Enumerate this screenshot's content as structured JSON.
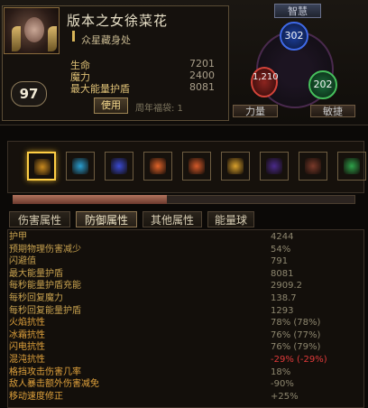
{
  "character": {
    "name": "版本之女徐菜花",
    "subline": "众星藏身处",
    "level": "97",
    "use_button": "使用",
    "anniversary_label": "周年福袋: 1",
    "stats": [
      {
        "label": "生命",
        "value": "7201"
      },
      {
        "label": "魔力",
        "value": "2400"
      },
      {
        "label": "最大能量护盾",
        "value": "8081"
      }
    ]
  },
  "attributes": {
    "wisdom_label": "智慧",
    "wisdom": "302",
    "strength_label": "力量",
    "strength": "1,210",
    "dexterity_label": "敏捷",
    "dexterity": "202"
  },
  "equipment_icons": [
    {
      "icon": "sword-icon",
      "color": "#c98a1f"
    },
    {
      "icon": "runner-icon",
      "color": "#2a9fd1"
    },
    {
      "icon": "arcane-icon",
      "color": "#3a4bd4"
    },
    {
      "icon": "fire-icon",
      "color": "#e2642a"
    },
    {
      "icon": "dash-icon",
      "color": "#d45a2a"
    },
    {
      "icon": "bolt-icon",
      "color": "#d9a12c"
    },
    {
      "icon": "wave-icon",
      "color": "#4a2a8a"
    },
    {
      "icon": "orb-icon",
      "color": "#7a3a2a"
    },
    {
      "icon": "chest-icon",
      "color": "#2ea24a"
    }
  ],
  "progress": 0.45,
  "tabs": [
    {
      "label": "伤害属性",
      "active": false
    },
    {
      "label": "防御属性",
      "active": true
    },
    {
      "label": "其他属性",
      "active": false
    },
    {
      "label": "能量球",
      "active": false
    }
  ],
  "defense_rows": [
    {
      "label": "护甲",
      "value": "4244",
      "color": "#c8a24f"
    },
    {
      "label": "预期物理伤害减少",
      "value": "54%",
      "color": "#c8a24f"
    },
    {
      "label": "闪避值",
      "value": "791",
      "color": "#c8a24f"
    },
    {
      "label": "最大能量护盾",
      "value": "8081",
      "color": "#c8a24f"
    },
    {
      "label": "每秒能量护盾充能",
      "value": "2909.2",
      "color": "#c8a24f"
    },
    {
      "label": "每秒回复魔力",
      "value": "138.7",
      "color": "#c8a24f"
    },
    {
      "label": "每秒回复能量护盾",
      "value": "1293",
      "color": "#c8a24f"
    },
    {
      "label": "火焰抗性",
      "value": "78% (78%)",
      "color": "#e0a23c"
    },
    {
      "label": "冰霜抗性",
      "value": "76% (77%)",
      "color": "#e0a23c"
    },
    {
      "label": "闪电抗性",
      "value": "76% (79%)",
      "color": "#e0a23c"
    },
    {
      "label": "混沌抗性",
      "value": "-29% (-29%)",
      "color": "#e0a23c",
      "value_color": "#e03a3a"
    },
    {
      "label": "格挡攻击伤害几率",
      "value": "18%",
      "color": "#e0a23c"
    },
    {
      "label": "敌人暴击额外伤害减免",
      "value": "-90%",
      "color": "#e0a23c"
    },
    {
      "label": "移动速度修正",
      "value": "+25%",
      "color": "#e0a23c"
    }
  ]
}
